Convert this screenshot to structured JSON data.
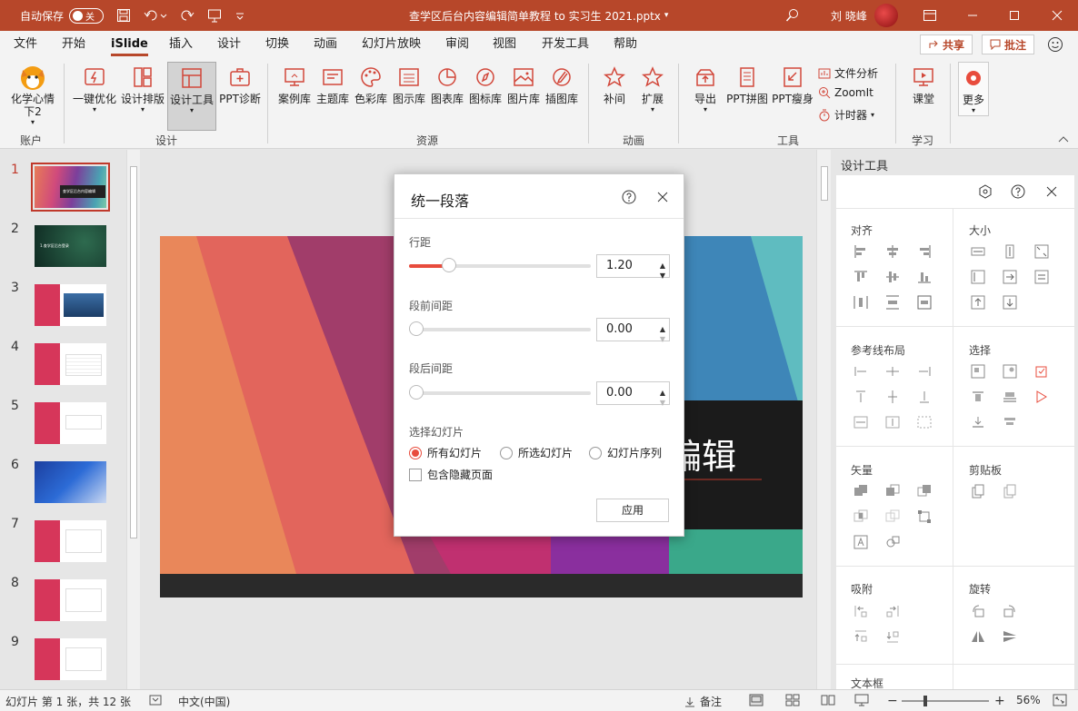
{
  "titlebar": {
    "autosave_label": "自动保存",
    "autosave_state": "关",
    "doc_title": "查学区后台内容编辑简单教程 to 实习生 2021.pptx",
    "user_name": "刘 晓峰"
  },
  "menu": {
    "tabs": [
      "文件",
      "开始",
      "iSlide",
      "插入",
      "设计",
      "切换",
      "动画",
      "幻灯片放映",
      "审阅",
      "视图",
      "开发工具",
      "帮助"
    ],
    "active": "iSlide",
    "share": "共享",
    "comment": "批注"
  },
  "ribbon": {
    "account_btn": "化学心情下2",
    "buttons": [
      "一键优化",
      "设计排版",
      "设计工具",
      "PPT诊断",
      "案例库",
      "主题库",
      "色彩库",
      "图示库",
      "图表库",
      "图标库",
      "图片库",
      "插图库",
      "补间",
      "扩展",
      "导出",
      "PPT拼图",
      "PPT瘦身",
      "课堂",
      "更多"
    ],
    "small": [
      "文件分析",
      "ZoomIt",
      "计时器"
    ],
    "groups": [
      "账户",
      "设计",
      "资源",
      "动画",
      "工具",
      "学习"
    ]
  },
  "thumbnails": {
    "numbers": [
      "1",
      "2",
      "3",
      "4",
      "5",
      "6",
      "7",
      "8",
      "9"
    ],
    "selected": "1",
    "slide1_text": "查学区后台内容编辑",
    "slide2_text": "1.查学区后台登录"
  },
  "slide": {
    "title_fragment": "编辑"
  },
  "dialog": {
    "title": "统一段落",
    "line_spacing_label": "行距",
    "line_spacing_value": "1.20",
    "line_spacing_fraction": 0.22,
    "before_label": "段前间距",
    "before_value": "0.00",
    "after_label": "段后间距",
    "after_value": "0.00",
    "select_label": "选择幻灯片",
    "options": [
      "所有幻灯片",
      "所选幻灯片",
      "幻灯片序列"
    ],
    "selected_option": "所有幻灯片",
    "hidden_label": "包含隐藏页面",
    "apply": "应用"
  },
  "right_panel": {
    "title": "设计工具",
    "sections": [
      "对齐",
      "大小",
      "参考线布局",
      "选择",
      "矢量",
      "剪贴板",
      "吸附",
      "旋转",
      "文本框"
    ]
  },
  "statusbar": {
    "slide_info": "幻灯片 第 1 张，共 12 张",
    "language": "中文(中国)",
    "notes": "备注",
    "zoom": "56%"
  },
  "colors": {
    "titlebar": "#b7472a",
    "accent": "#e84c3d"
  }
}
